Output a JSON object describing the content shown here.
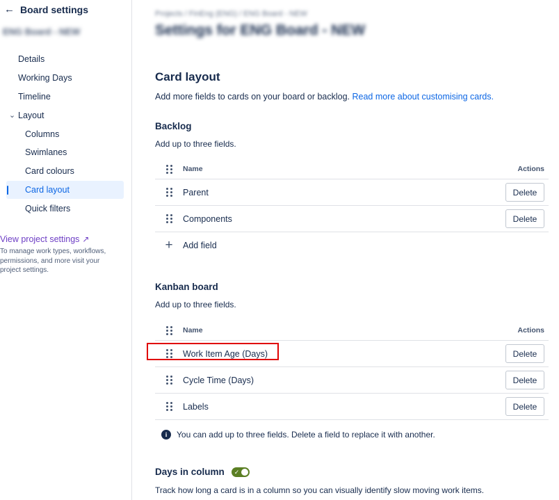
{
  "sidebar": {
    "title": "Board settings",
    "project_name": "ENG Board - NEW",
    "nav": [
      {
        "label": "Details"
      },
      {
        "label": "Working Days"
      },
      {
        "label": "Timeline"
      },
      {
        "label": "Layout"
      },
      {
        "label": "Columns"
      },
      {
        "label": "Swimlanes"
      },
      {
        "label": "Card colours"
      },
      {
        "label": "Card layout"
      },
      {
        "label": "Quick filters"
      }
    ],
    "view_project_settings": "View project settings",
    "view_project_settings_desc": "To manage work types, workflows, permissions, and more visit your project settings."
  },
  "main": {
    "breadcrumb": "Projects  /  FinEng (ENG)  /  ENG Board - NEW",
    "page_title": "Settings for ENG Board - NEW",
    "card_layout": {
      "heading": "Card layout",
      "desc": "Add more fields to cards on your board or backlog.",
      "link": "Read more about customising cards."
    },
    "backlog": {
      "heading": "Backlog",
      "desc": "Add up to three fields.",
      "col_name": "Name",
      "col_actions": "Actions",
      "rows": [
        {
          "name": "Parent",
          "action": "Delete"
        },
        {
          "name": "Components",
          "action": "Delete"
        }
      ],
      "add_field": "Add field"
    },
    "kanban": {
      "heading": "Kanban board",
      "desc": "Add up to three fields.",
      "col_name": "Name",
      "col_actions": "Actions",
      "rows": [
        {
          "name": "Work Item Age (Days)",
          "action": "Delete"
        },
        {
          "name": "Cycle Time (Days)",
          "action": "Delete"
        },
        {
          "name": "Labels",
          "action": "Delete"
        }
      ],
      "info": "You can add up to three fields. Delete a field to replace it with another."
    },
    "days_in_column": {
      "heading": "Days in column",
      "enabled": true,
      "desc": "Track how long a card is in a column so you can visually identify slow moving work items."
    }
  },
  "colors": {
    "accent_blue": "#0c66e4",
    "link_purple": "#6e3fc5",
    "toggle_green": "#5b7f24",
    "highlight_red": "#e00000"
  }
}
